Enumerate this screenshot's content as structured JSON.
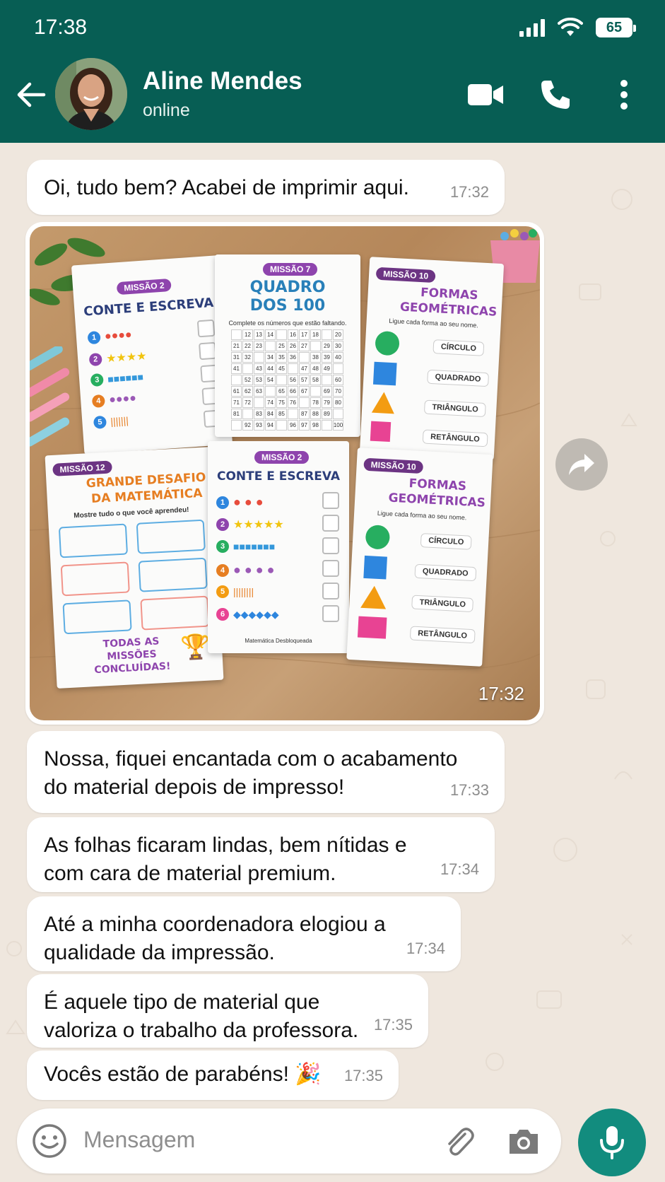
{
  "status_bar": {
    "time": "17:38",
    "battery": "65"
  },
  "header": {
    "contact_name": "Aline Mendes",
    "contact_status": "online"
  },
  "messages": [
    {
      "text": "Oi, tudo bem? Acabei de imprimir aqui.",
      "time": "17:32"
    },
    {
      "text": "Nossa, fiquei encantada com o acabamento do material depois de impresso!",
      "time": "17:33"
    },
    {
      "text": "As folhas ficaram lindas, bem nítidas e com cara de material premium.",
      "time": "17:34"
    },
    {
      "text": "Até a minha coordenadora elogiou a qualidade da impressão.",
      "time": "17:34"
    },
    {
      "text": "É aquele tipo de material que valoriza o trabalho da professora.",
      "time": "17:35"
    },
    {
      "text": "Vocês estão de parabéns! 🎉",
      "time": "17:35"
    }
  ],
  "image_message": {
    "time": "17:32",
    "sheets": {
      "conte": {
        "tag": "MISSÃO 2",
        "title": "CONTE E ESCREVA"
      },
      "quadro": {
        "tag": "MISSÃO 7",
        "title": "QUADRO DOS 100",
        "subtitle": "Complete os números que estão faltando."
      },
      "formas": {
        "tag": "MISSÃO 10",
        "title": "FORMAS GEOMÉTRICAS",
        "subtitle": "Ligue cada forma ao seu nome.",
        "labels": [
          "CÍRCULO",
          "QUADRADO",
          "TRIÂNGULO",
          "RETÂNGULO"
        ]
      },
      "desafio": {
        "tag": "MISSÃO 12",
        "title": "GRANDE DESAFIO DA MATEMÁTICA",
        "subtitle": "Mostre tudo o que você aprendeu!",
        "footer": "TODAS AS MISSÕES CONCLUÍDAS!"
      },
      "footer_credit": "Matemática Desbloqueada"
    }
  },
  "input": {
    "placeholder": "Mensagem"
  },
  "colors": {
    "header": "#075e54",
    "accent": "#128c7e",
    "chat_bg": "#efe7de"
  }
}
